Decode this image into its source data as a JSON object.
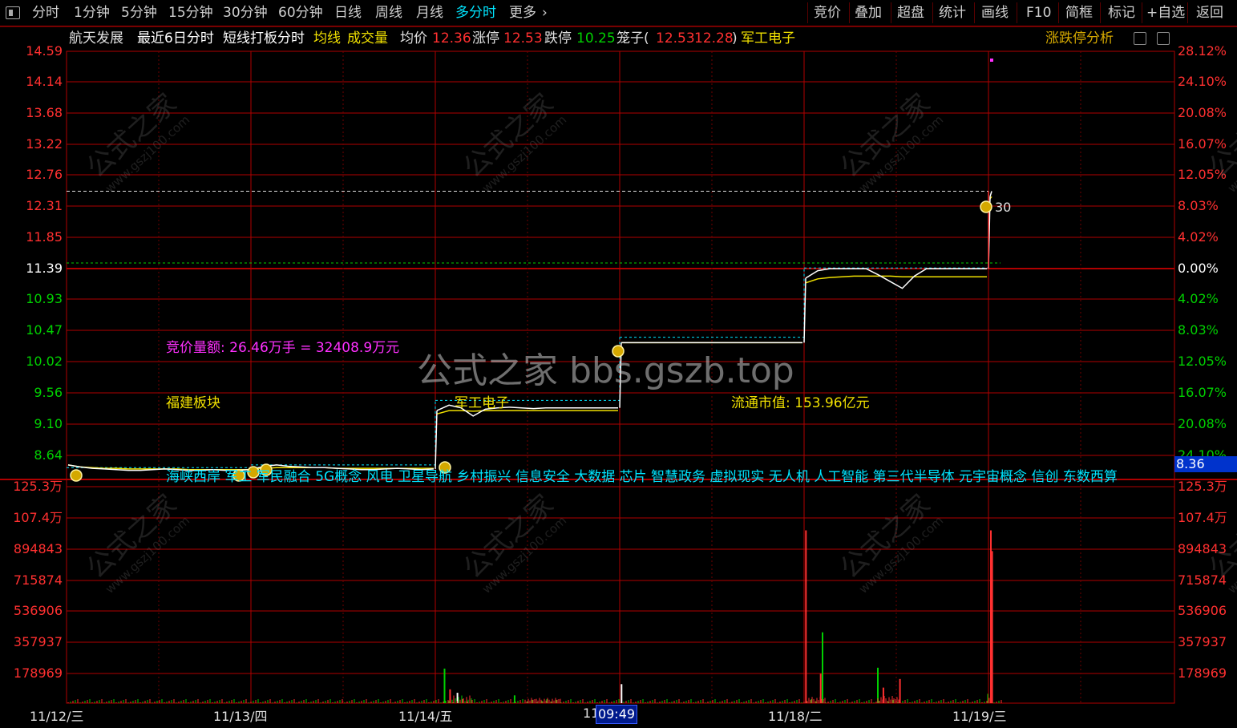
{
  "toolbar": {
    "left_tabs": [
      "分时",
      "1分钟",
      "5分钟",
      "15分钟",
      "30分钟",
      "60分钟",
      "日线",
      "周线",
      "月线",
      "多分时",
      "更多"
    ],
    "active_tab": "多分时",
    "right_buttons": [
      "竞价",
      "叠加",
      "超盘",
      "统计",
      "画线",
      "F10",
      "简框",
      "标记",
      "+自选",
      "返回"
    ]
  },
  "info": {
    "stock_name": "航天发展",
    "period": "最近6日分时",
    "strategy": "短线打板分时",
    "avg_line_label": "均线",
    "volume_label": "成交量",
    "avg_price_label": "均价",
    "avg_price": "12.36",
    "limit_up_label": "涨停",
    "limit_up": "12.53",
    "limit_down_label": "跌停",
    "limit_down": "10.25",
    "cage_label": "笼子(",
    "cage_high": "12.53",
    "cage_low": "12.28",
    "cage_close": ")",
    "sector": "军工电子",
    "right_title": "涨跌停分析"
  },
  "price_axis": {
    "left": [
      "14.59",
      "14.14",
      "13.68",
      "13.22",
      "12.76",
      "12.31",
      "11.85",
      "11.39",
      "10.93",
      "10.47",
      "10.02",
      "9.56",
      "9.10",
      "8.64"
    ],
    "right": [
      "28.12%",
      "24.10%",
      "20.08%",
      "16.07%",
      "12.05%",
      "8.03%",
      "4.02%",
      "0.00%",
      "4.02%",
      "8.03%",
      "12.05%",
      "16.07%",
      "20.08%",
      "24.10%"
    ],
    "right_highlight": "8.36"
  },
  "volume_axis": {
    "labels": [
      "125.3万",
      "107.4万",
      "894843",
      "715874",
      "536906",
      "357937",
      "178969"
    ]
  },
  "x_axis": {
    "dates": [
      "11/12/三",
      "11/13/四",
      "11/14/五",
      "11",
      "11/18/二",
      "11/19/三"
    ],
    "time_cursor": "09:49"
  },
  "annotations": {
    "auction": "竞价量额: 26.46万手 = 32408.9万元",
    "region": "福建板块",
    "sector_tag": "军工电子",
    "float_cap": "流通市值: 153.96亿元",
    "price_tag": "30"
  },
  "concepts": [
    "海峡西岸",
    "军工",
    "军民融合",
    "5G概念",
    "风电",
    "卫星导航",
    "乡村振兴",
    "信息安全",
    "大数据",
    "芯片",
    "智慧政务",
    "虚拟现实",
    "无人机",
    "人工智能",
    "第三代半导体",
    "元宇宙概念",
    "信创",
    "东数西算"
  ],
  "watermark": {
    "center": "公式之家 bbs.gszb.top",
    "tile_main": "公式之家",
    "tile_sub": "www.gszj100.com"
  },
  "colors": {
    "up": "#ff3030",
    "down": "#00d000",
    "grid": "#b00000",
    "avg": "#f0e000",
    "price": "#ffffff",
    "accent": "#00e5ff",
    "magenta": "#ff30ff"
  },
  "chart_data": {
    "type": "line",
    "title": "航天发展 最近6日分时",
    "days": [
      "11/12",
      "11/13",
      "11/14",
      "11/17",
      "11/18",
      "11/19"
    ],
    "prev_close": 11.39,
    "price_range": [
      8.36,
      14.59
    ],
    "series": [
      {
        "name": "价格",
        "values_per_day": [
          [
            8.5,
            8.47,
            8.45,
            8.44,
            8.43,
            8.42,
            8.42,
            8.43,
            8.44,
            8.43,
            8.42,
            8.42,
            8.43,
            8.42,
            8.42,
            8.43
          ],
          [
            8.44,
            8.48,
            8.5,
            8.48,
            8.47,
            8.46,
            8.46,
            8.45,
            8.44,
            8.43,
            8.43,
            8.44,
            8.45,
            8.44,
            8.43,
            8.44
          ],
          [
            9.3,
            9.38,
            9.34,
            9.22,
            9.32,
            9.34,
            9.35,
            9.34,
            9.33,
            9.34,
            9.34,
            9.34,
            9.34,
            9.34,
            9.34,
            9.34
          ],
          [
            10.3,
            10.3,
            10.3,
            10.3,
            10.3,
            10.3,
            10.3,
            10.3,
            10.3,
            10.3,
            10.3,
            10.3,
            10.3,
            10.3,
            10.3,
            10.3
          ],
          [
            11.25,
            11.36,
            11.39,
            11.39,
            11.39,
            11.39,
            11.3,
            11.2,
            11.1,
            11.28,
            11.39,
            11.39,
            11.39,
            11.39,
            11.39,
            11.39
          ],
          [
            12.45,
            12.53
          ]
        ]
      },
      {
        "name": "均线",
        "values_per_day": [
          [
            8.5,
            8.47,
            8.46,
            8.45,
            8.45,
            8.44,
            8.44,
            8.44,
            8.44,
            8.44,
            8.43,
            8.43,
            8.43,
            8.43,
            8.43,
            8.43
          ],
          [
            8.44,
            8.45,
            8.46,
            8.46,
            8.46,
            8.46,
            8.46,
            8.45,
            8.45,
            8.45,
            8.45,
            8.45,
            8.45,
            8.45,
            8.45,
            8.45
          ],
          [
            9.25,
            9.3,
            9.3,
            9.29,
            9.3,
            9.3,
            9.3,
            9.3,
            9.3,
            9.3,
            9.3,
            9.3,
            9.3,
            9.3,
            9.3,
            9.3
          ],
          [
            10.3,
            10.3,
            10.3,
            10.3,
            10.3,
            10.3,
            10.3,
            10.3,
            10.3,
            10.3,
            10.3,
            10.3,
            10.3,
            10.3,
            10.3,
            10.3
          ],
          [
            11.18,
            11.24,
            11.26,
            11.27,
            11.28,
            11.28,
            11.28,
            11.28,
            11.27,
            11.27,
            11.27,
            11.27,
            11.27,
            11.27,
            11.27,
            11.27
          ],
          [
            12.42,
            12.45
          ]
        ]
      }
    ],
    "volume_max": 1253000,
    "volume_spikes": [
      {
        "day": 2,
        "pos": 0.05,
        "value": 200000,
        "color": "green"
      },
      {
        "day": 2,
        "pos": 0.08,
        "value": 80000,
        "color": "red"
      },
      {
        "day": 2,
        "pos": 0.12,
        "value": 60000,
        "color": "white"
      },
      {
        "day": 2,
        "pos": 0.43,
        "value": 45000,
        "color": "green"
      },
      {
        "day": 3,
        "pos": 0.01,
        "value": 110000,
        "color": "white"
      },
      {
        "day": 4,
        "pos": 0.01,
        "value": 1000000,
        "color": "red"
      },
      {
        "day": 4,
        "pos": 0.1,
        "value": 410000,
        "color": "green"
      },
      {
        "day": 4,
        "pos": 0.09,
        "value": 170000,
        "color": "red"
      },
      {
        "day": 4,
        "pos": 0.4,
        "value": 205000,
        "color": "green"
      },
      {
        "day": 4,
        "pos": 0.43,
        "value": 90000,
        "color": "red"
      },
      {
        "day": 4,
        "pos": 0.52,
        "value": 140000,
        "color": "red"
      },
      {
        "day": 5,
        "pos": 0.02,
        "value": 880000,
        "color": "red"
      }
    ]
  }
}
